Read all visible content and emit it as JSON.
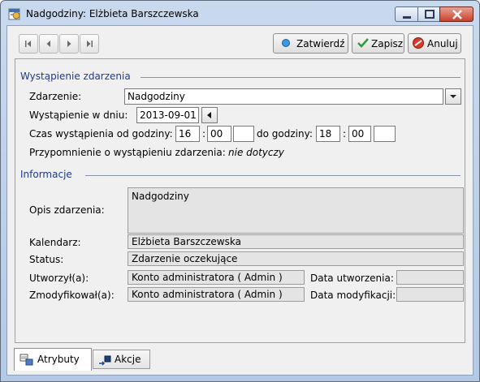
{
  "window": {
    "title": "Nadgodziny: Elżbieta Barszczewska"
  },
  "toolbar": {
    "confirm_label": "Zatwierdź",
    "save_label": "Zapisz",
    "cancel_label": "Anuluj"
  },
  "occurrence": {
    "section_title": "Wystąpienie zdarzenia",
    "event_label": "Zdarzenie:",
    "event_value": "Nadgodziny",
    "date_label": "Wystąpienie w dniu:",
    "date_value": "2013-09-01",
    "time_from_label": "Czas wystąpienia od godziny:",
    "from_hour": "16",
    "from_minute": "00",
    "from_extra": "",
    "time_to_label": "do godziny:",
    "to_hour": "18",
    "to_minute": "00",
    "to_extra": "",
    "colon": ":",
    "reminder_label": "Przypomnienie o wystąpieniu zdarzenia:",
    "reminder_value": "nie dotyczy"
  },
  "info": {
    "section_title": "Informacje",
    "description_label": "Opis zdarzenia:",
    "description_value": "Nadgodziny",
    "calendar_label": "Kalendarz:",
    "calendar_value": "Elżbieta Barszczewska",
    "status_label": "Status:",
    "status_value": "Zdarzenie oczekujące",
    "created_by_label": "Utworzył(a):",
    "created_by_value": "Konto administratora ( Admin )",
    "created_date_label": "Data utworzenia:",
    "created_date_value": "",
    "modified_by_label": "Zmodyfikował(a):",
    "modified_by_value": "Konto administratora ( Admin )",
    "modified_date_label": "Data modyfikacji:",
    "modified_date_value": ""
  },
  "tabs": [
    {
      "label": "Atrybuty",
      "active": true
    },
    {
      "label": "Akcje",
      "active": false
    }
  ],
  "colors": {
    "section_heading": "#1f3a8a",
    "title_bar": "#b4c9e6",
    "close_button": "#c8412c"
  }
}
